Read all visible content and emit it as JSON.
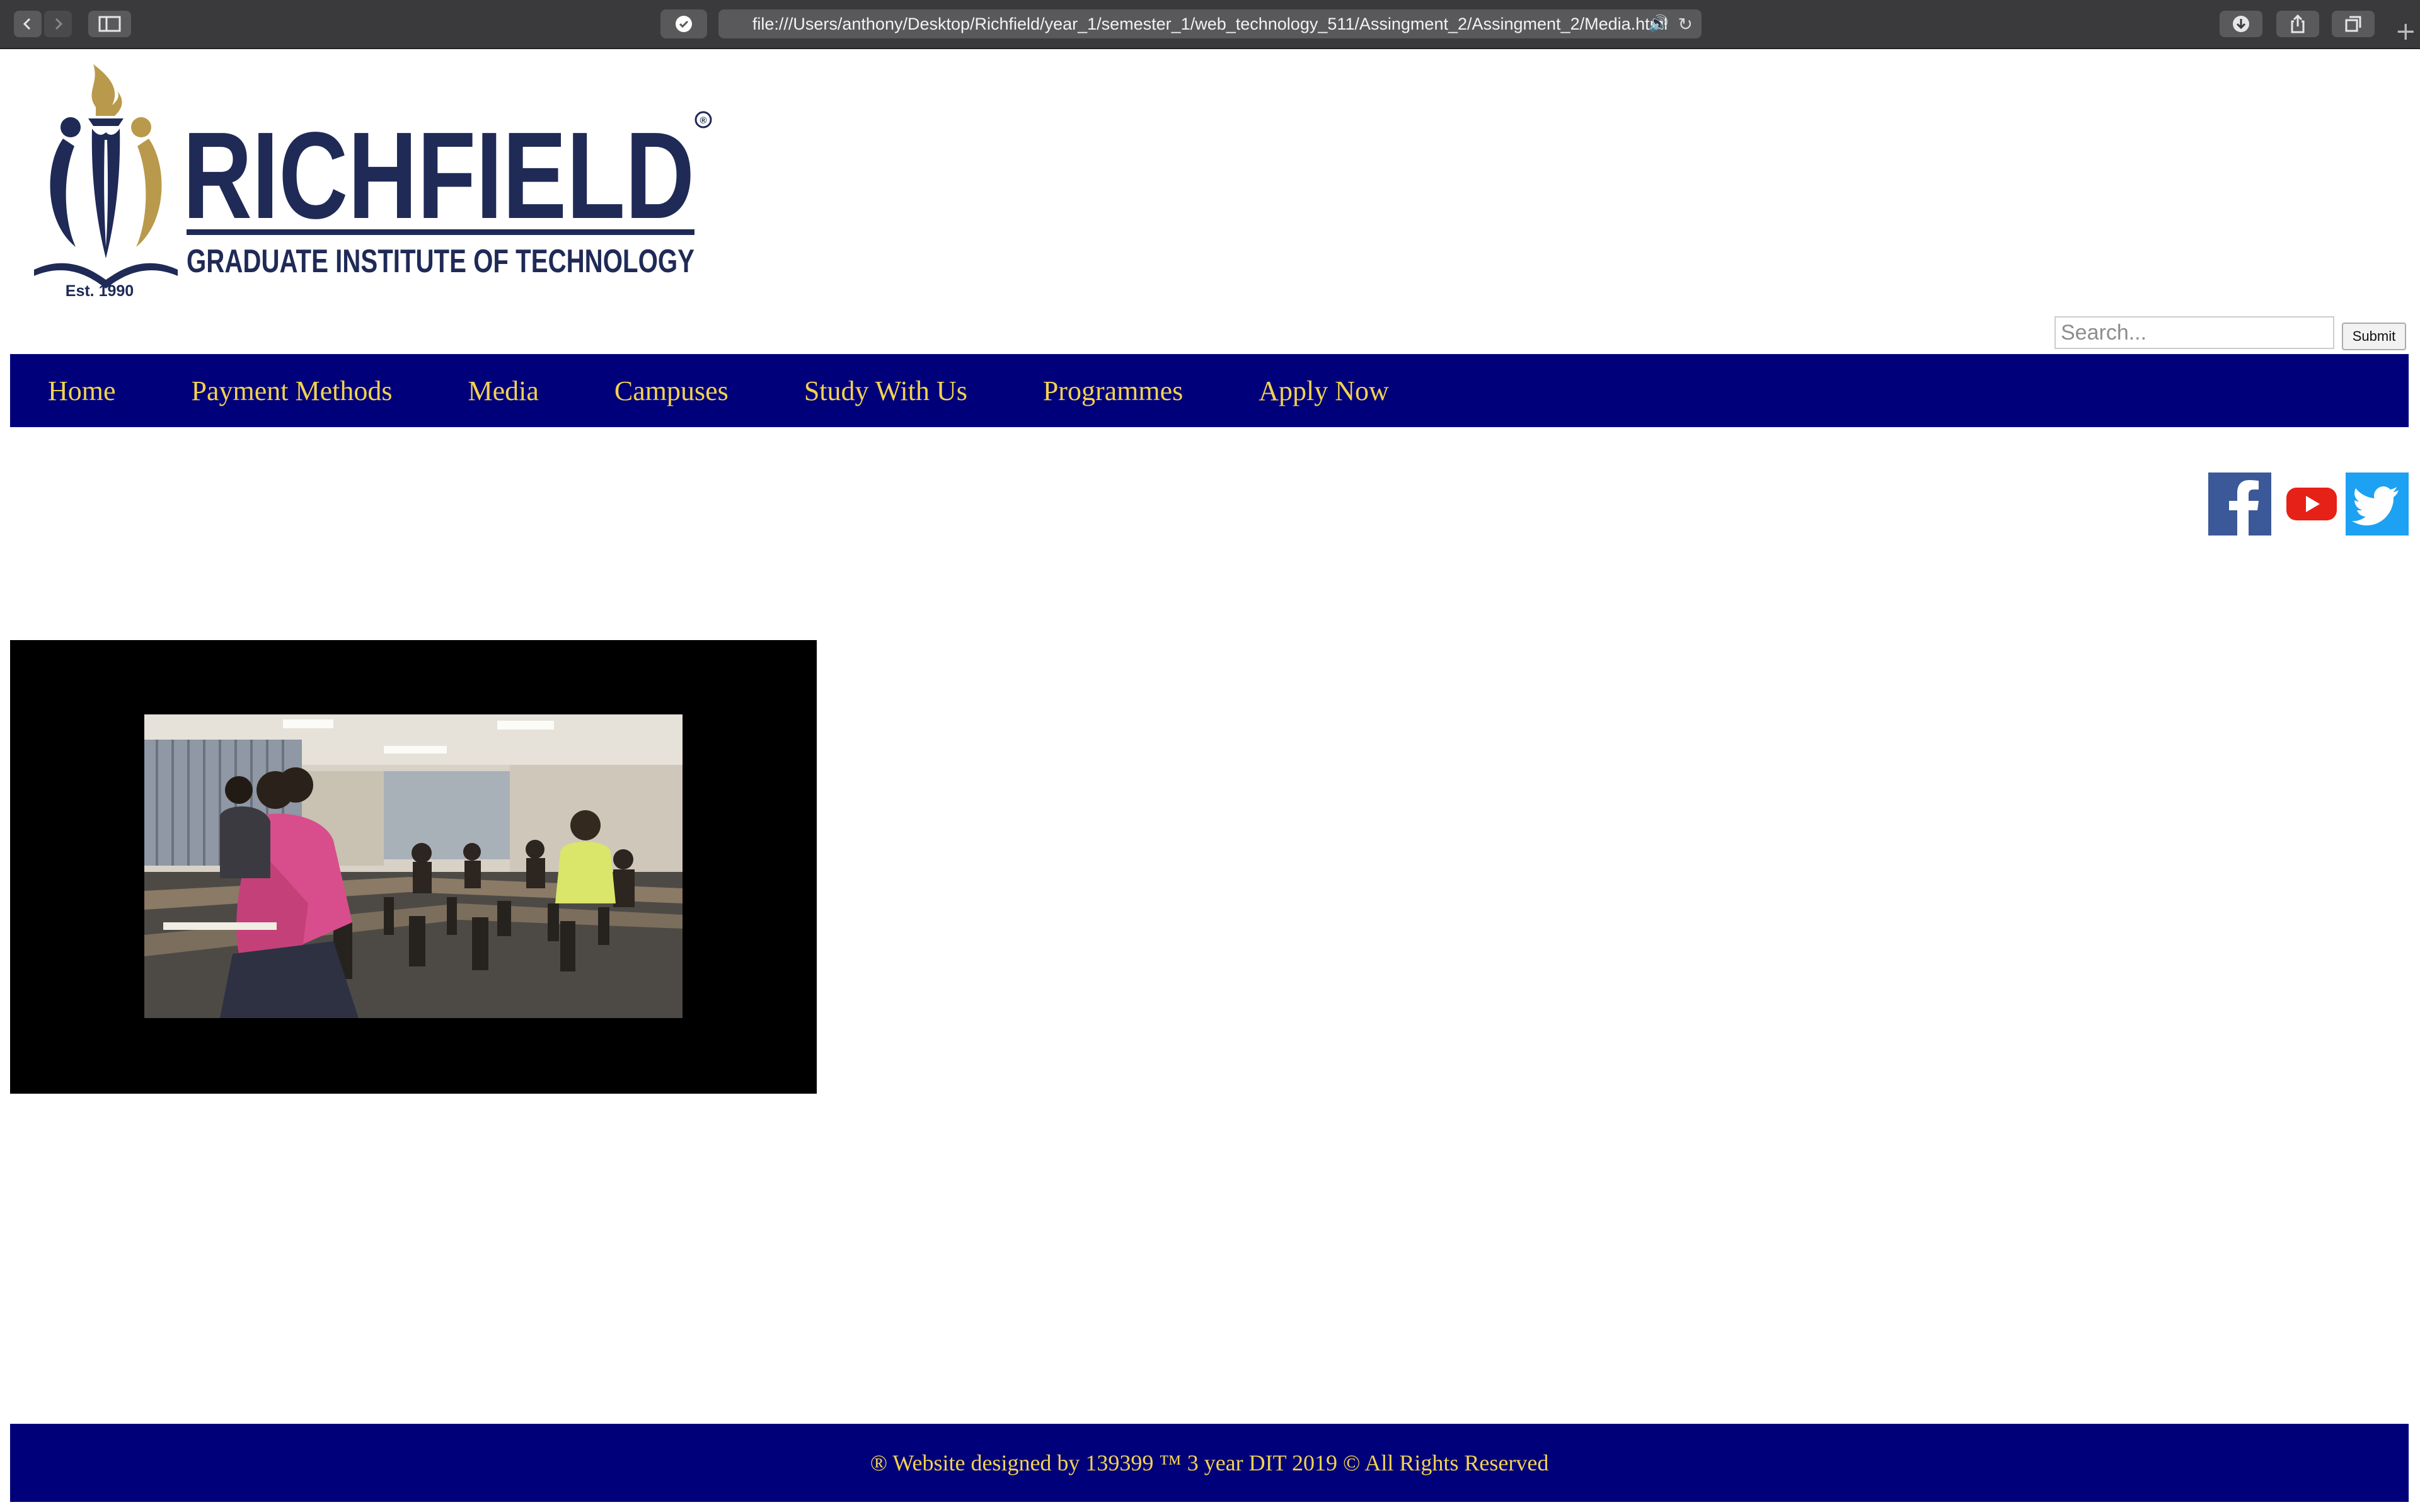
{
  "browser": {
    "url": "file:///Users/anthony/Desktop/Richfield/year_1/semester_1/web_technology_511/Assingment_2/Assingment_2/Media.html",
    "back_icon": "chevron-left-icon",
    "forward_icon": "chevron-right-icon",
    "sidebar_icon": "sidebar-icon",
    "shield_icon": "checkmark-shield-icon",
    "audio_icon": "speaker-icon",
    "reload_icon": "reload-icon",
    "download_icon": "download-icon",
    "share_icon": "share-icon",
    "tabs_icon": "tabs-overview-icon",
    "newtab_icon": "plus-icon"
  },
  "logo": {
    "name": "RICHFIELD",
    "tagline": "GRADUATE INSTITUTE OF TECHNOLOGY",
    "established": "Est. 1990",
    "registered_mark": "®",
    "colors": {
      "navy": "#1f2a56",
      "gold": "#b99a4c"
    }
  },
  "search": {
    "placeholder": "Search...",
    "value": "",
    "submit_label": "Submit"
  },
  "nav": {
    "background": "#00007a",
    "text_color": "#f2d24f",
    "items": [
      {
        "label": "Home"
      },
      {
        "label": "Payment Methods"
      },
      {
        "label": "Media"
      },
      {
        "label": "Campuses"
      },
      {
        "label": "Study With Us"
      },
      {
        "label": "Programmes"
      },
      {
        "label": "Apply Now"
      }
    ]
  },
  "social": [
    {
      "name": "facebook-icon",
      "color": "#3b5998"
    },
    {
      "name": "youtube-icon",
      "color": "#e62117"
    },
    {
      "name": "twitter-icon",
      "color": "#1da1f2"
    }
  ],
  "video": {
    "scene": "classroom-video-frame"
  },
  "footer": {
    "text": "® Website designed by 139399 ™  3 year DIT 2019 © All Rights Reserved"
  }
}
